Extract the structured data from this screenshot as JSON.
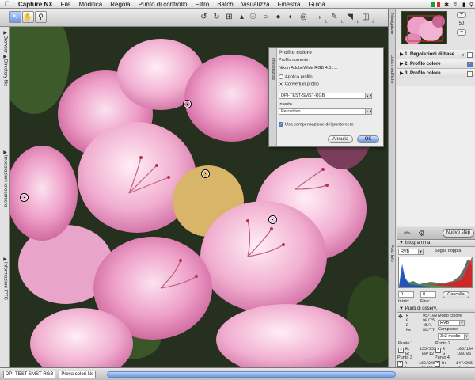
{
  "menubar": {
    "apple": "",
    "app": "Capture NX",
    "items": [
      "File",
      "Modifica",
      "Regola",
      "Punto di controllo",
      "Filtro",
      "Batch",
      "Visualizza",
      "Finestra",
      "Guida"
    ]
  },
  "toolbar": {
    "tool_labels": [
      "Sel.",
      "Pannello",
      "Zoom",
      "Ruota",
      "Ritaglia",
      "Raddrizza",
      "Punto colore",
      "Punto bianco",
      "Punto nero",
      "Punto neutro",
      "Occhi rossi",
      "Lazo",
      "Pennello",
      "Gradiente",
      "Riempi"
    ],
    "small_marks": [
      "L",
      "L",
      "L",
      "L"
    ]
  },
  "left_strip": {
    "tabs": [
      "Browser",
      "Directory file",
      "Impostazioni fotocamera",
      "Informazioni IPTC"
    ]
  },
  "dialog": {
    "side_label": "Impostazioni",
    "title": "Profilo colore",
    "current_label": "Profilo corrente:",
    "current_value": "Nikon AdobeWide RGB 4.0.....",
    "radio_apply": "Applica profilo",
    "radio_convert": "Converti in profilo",
    "profile_select": "DPI-TEST-SMST-RGB",
    "intent_label": "Intento",
    "intent_select": "Percettivo",
    "checkbox_label": "Usa compensazione del punto nero",
    "cancel": "Annulla",
    "ok": "OK"
  },
  "navigator": {
    "side_label": "Navigatore",
    "zoom_plus": "+",
    "zoom_value": "50",
    "zoom_minus": "−"
  },
  "edit_list": {
    "side_label": "Lista modifiche",
    "steps": [
      {
        "label": "1. Regolazioni di base",
        "checked": false
      },
      {
        "label": "2. Profilo colore",
        "checked": true
      },
      {
        "label": "3. Profilo colore",
        "checked": false
      }
    ],
    "new_step_button": "Nuovo step"
  },
  "photo_info": {
    "side_label": "Foto Info",
    "histogram_title": "Istogramma",
    "channel_select": "RVB",
    "threshold_label": "Soglia doppia",
    "start_value": "0",
    "end_value": "0",
    "cancel_button": "Cancella",
    "start_label": "Inizio:",
    "end_label": "Fine:",
    "watch_points_title": "Punti di osserv.",
    "color_mode_label": "Modo colore",
    "color_mode_select": "RVB",
    "sample_label": "Campione",
    "sample_select": "3x3 medio",
    "current_values": "R      95/109\nG      90/75\nB      45/1\nMe     86/77",
    "points": [
      {
        "name": "Punto 1",
        "values": "R:    155/255\nG:     89/12\nB:     90/35\nMe:   109/89"
      },
      {
        "name": "Punto 2",
        "values": "R:    106/134\nG:    100/85\nB:     35/0\nMe:    99/93"
      },
      {
        "name": "Punto 3",
        "values": "R:    169/245\nG:    134/96\nB:    144/120\nMe:   148/144"
      },
      {
        "name": "Punto 4",
        "values": "R:    147/255\nG:     91/41\nB:    100/68\nMe:   103/101"
      }
    ]
  },
  "status": {
    "profile": "DPI-TEST-SMST-RGB",
    "proof": "Prova colori No"
  },
  "colors": {
    "accent": "#4d7ee3",
    "petal": "#e58bb9",
    "leaf": "#2e4a22"
  }
}
